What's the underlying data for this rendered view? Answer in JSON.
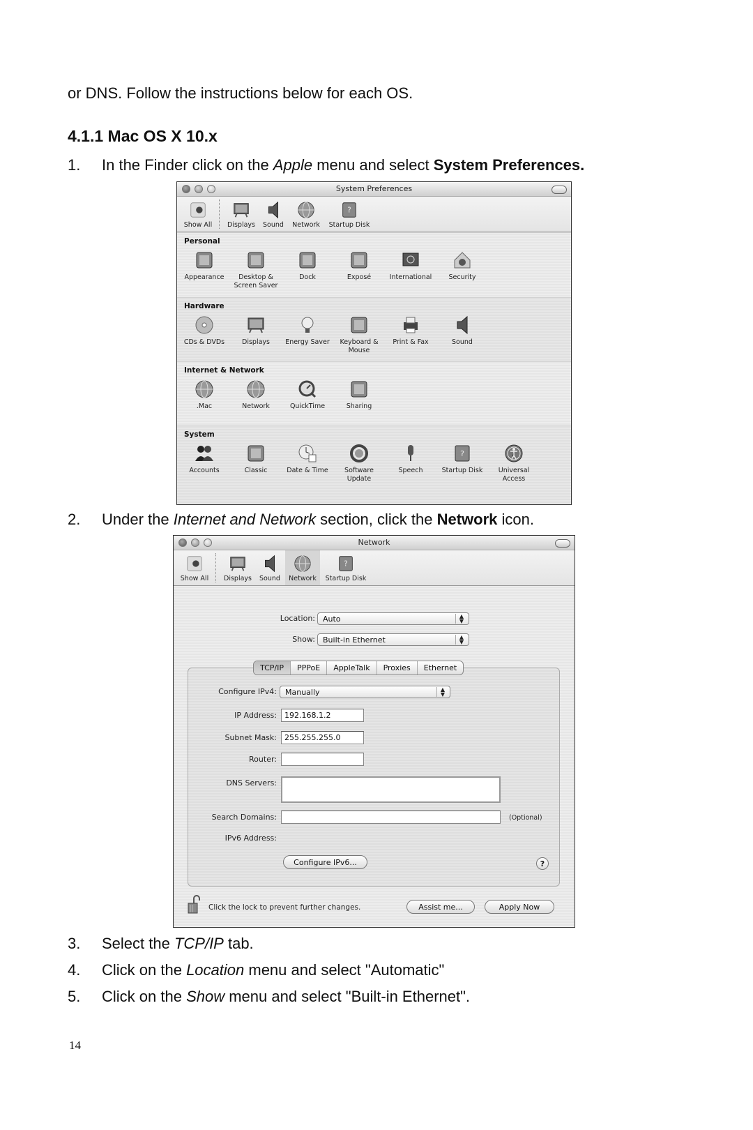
{
  "doc": {
    "intro": "or DNS. Follow the instructions below for each OS.",
    "heading": "4.1.1 Mac OS X 10.x",
    "steps": [
      {
        "num": "1.",
        "parts": [
          {
            "t": "In the Finder click on the ",
            "s": "n"
          },
          {
            "t": "Apple",
            "s": "i"
          },
          {
            "t": " menu and select ",
            "s": "n"
          },
          {
            "t": "System Preferences.",
            "s": "b"
          }
        ]
      },
      {
        "num": "2.",
        "parts": [
          {
            "t": "Under the ",
            "s": "n"
          },
          {
            "t": "Internet and Network",
            "s": "i"
          },
          {
            "t": " section, click the ",
            "s": "n"
          },
          {
            "t": "Network",
            "s": "b"
          },
          {
            "t": " icon.",
            "s": "n"
          }
        ]
      },
      {
        "num": "3.",
        "parts": [
          {
            "t": "Select the ",
            "s": "n"
          },
          {
            "t": "TCP/IP",
            "s": "i"
          },
          {
            "t": " tab.",
            "s": "n"
          }
        ]
      },
      {
        "num": "4.",
        "parts": [
          {
            "t": "Click on the ",
            "s": "n"
          },
          {
            "t": "Location",
            "s": "i"
          },
          {
            "t": " menu and select \"Automatic\"",
            "s": "n"
          }
        ]
      },
      {
        "num": "5.",
        "parts": [
          {
            "t": "Click on the ",
            "s": "n"
          },
          {
            "t": "Show",
            "s": "i"
          },
          {
            "t": " menu and select \"Built-in Ethernet\".",
            "s": "n"
          }
        ]
      }
    ],
    "page_number": "14"
  },
  "syspref": {
    "title": "System Preferences",
    "toolbar": [
      "Show All",
      "Displays",
      "Sound",
      "Network",
      "Startup Disk"
    ],
    "sections": [
      {
        "title": "Personal",
        "items": [
          "Appearance",
          "Desktop & Screen Saver",
          "Dock",
          "Exposé",
          "International",
          "Security"
        ]
      },
      {
        "title": "Hardware",
        "items": [
          "CDs & DVDs",
          "Displays",
          "Energy Saver",
          "Keyboard & Mouse",
          "Print & Fax",
          "Sound"
        ]
      },
      {
        "title": "Internet & Network",
        "items": [
          ".Mac",
          "Network",
          "QuickTime",
          "Sharing"
        ]
      },
      {
        "title": "System",
        "items": [
          "Accounts",
          "Classic",
          "Date & Time",
          "Software Update",
          "Speech",
          "Startup Disk",
          "Universal Access"
        ]
      }
    ]
  },
  "network": {
    "title": "Network",
    "toolbar": [
      "Show All",
      "Displays",
      "Sound",
      "Network",
      "Startup Disk"
    ],
    "selected_toolbar": "Network",
    "location_label": "Location:",
    "location_value": "Auto",
    "show_label": "Show:",
    "show_value": "Built-in Ethernet",
    "tabs": [
      "TCP/IP",
      "PPPoE",
      "AppleTalk",
      "Proxies",
      "Ethernet"
    ],
    "active_tab": "TCP/IP",
    "configure_label": "Configure IPv4:",
    "configure_value": "Manually",
    "ip_label": "IP Address:",
    "ip_value": "192.168.1.2",
    "subnet_label": "Subnet Mask:",
    "subnet_value": "255.255.255.0",
    "router_label": "Router:",
    "router_value": "",
    "dns_label": "DNS Servers:",
    "dns_value": "",
    "search_label": "Search Domains:",
    "search_value": "",
    "optional_label": "(Optional)",
    "ipv6_label": "IPv6 Address:",
    "configure_ipv6_button": "Configure IPv6...",
    "help_button": "?",
    "lock_text": "Click the lock to prevent further changes.",
    "assist_button": "Assist me...",
    "apply_button": "Apply Now"
  }
}
